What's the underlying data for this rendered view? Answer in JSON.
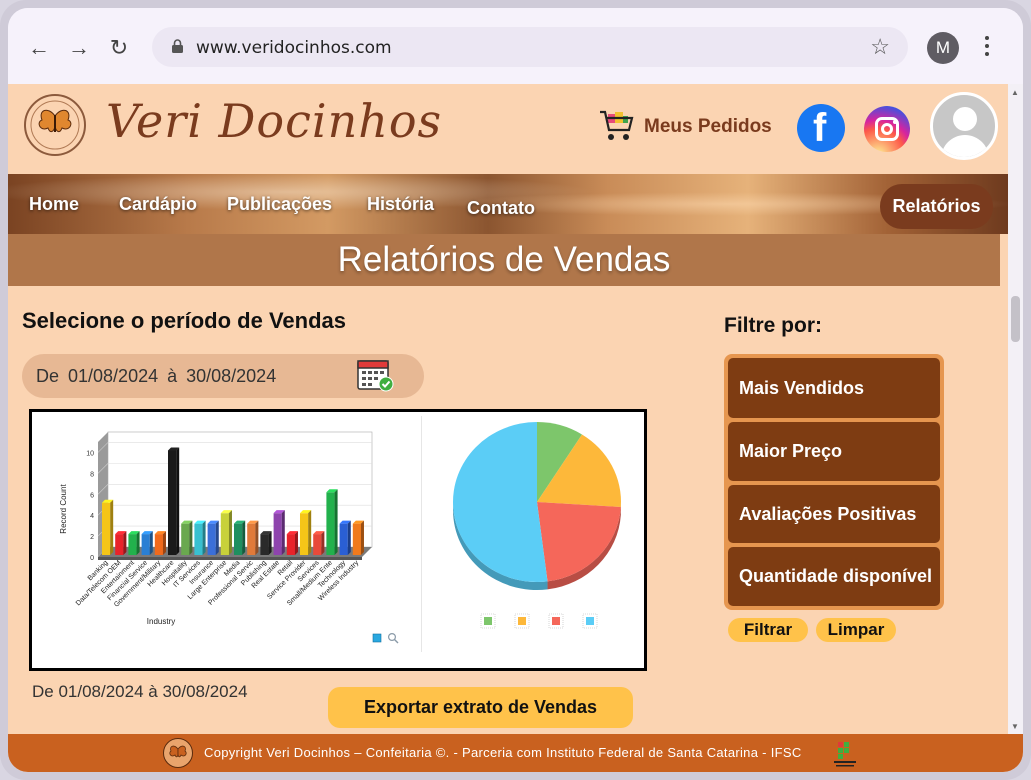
{
  "browser": {
    "url": "www.veridocinhos.com",
    "profile_initial": "M"
  },
  "header": {
    "brand": "Veri Docinhos",
    "orders_label": "Meus Pedidos"
  },
  "nav": {
    "items": [
      "Home",
      "Cardápio",
      "Publicações",
      "História",
      "Contato"
    ],
    "reports": "Relatórios"
  },
  "page": {
    "title": "Relatórios de Vendas",
    "select_period": "Selecione o período de Vendas",
    "period_text": "De  01/08/2024   à   30/08/2024",
    "range_text": "De 01/08/2024 à 30/08/2024",
    "export_label": "Exportar extrato de Vendas"
  },
  "filters": {
    "title": "Filtre por:",
    "items": [
      "Mais Vendidos",
      "Maior Preço",
      "Avaliações Positivas",
      "Quantidade disponível"
    ],
    "apply": "Filtrar",
    "clear": "Limpar"
  },
  "footer": {
    "text": "Copyright Veri Docinhos – Confeitaria ©. - Parceria com Instituto Federal de Santa Catarina - IFSC"
  },
  "colors": {
    "page_bg": "#fbd4b2",
    "brand_brown": "#7a3b1e",
    "accent_yellow": "#ffc24a",
    "footer": "#c9611f"
  },
  "chart_data": [
    {
      "type": "bar",
      "title": "",
      "xlabel": "Industry",
      "ylabel": "Record Count",
      "ylim": [
        0,
        11
      ],
      "yticks": [
        0,
        2,
        4,
        6,
        8,
        10
      ],
      "categories": [
        "Banking",
        "Data/Telecom OEM",
        "Entertainment",
        "Financial Service",
        "Government/Military",
        "Healthcare",
        "Hospitality",
        "IT Services",
        "Insurance",
        "Large Enterprise",
        "Media",
        "Professional Servic",
        "Publishing",
        "Real Estate",
        "Retail",
        "Service Provider",
        "Services",
        "Small/Medium Ente",
        "Technology",
        "Wireless Industry"
      ],
      "values": [
        5,
        2,
        2,
        2,
        2,
        10,
        3,
        3,
        3,
        4,
        3,
        3,
        2,
        4,
        2,
        4,
        2,
        6,
        3,
        3
      ],
      "colors": [
        "#f5c518",
        "#e8232a",
        "#22b14c",
        "#2a7fd4",
        "#f06a1c",
        "#1a1a1a",
        "#6aa84f",
        "#38c0d0",
        "#3b6fd8",
        "#c8d13a",
        "#1f8f5f",
        "#e07a3a",
        "#2a2a2a",
        "#8e44ad",
        "#e8232a",
        "#f5c518",
        "#e84a3a",
        "#22b14c",
        "#2a5fd4",
        "#f07a1c"
      ]
    },
    {
      "type": "pie",
      "values": [
        9,
        17,
        22,
        52
      ],
      "colors": [
        "#7dc66b",
        "#fdb83a",
        "#f5675a",
        "#5bcdf6"
      ]
    }
  ]
}
